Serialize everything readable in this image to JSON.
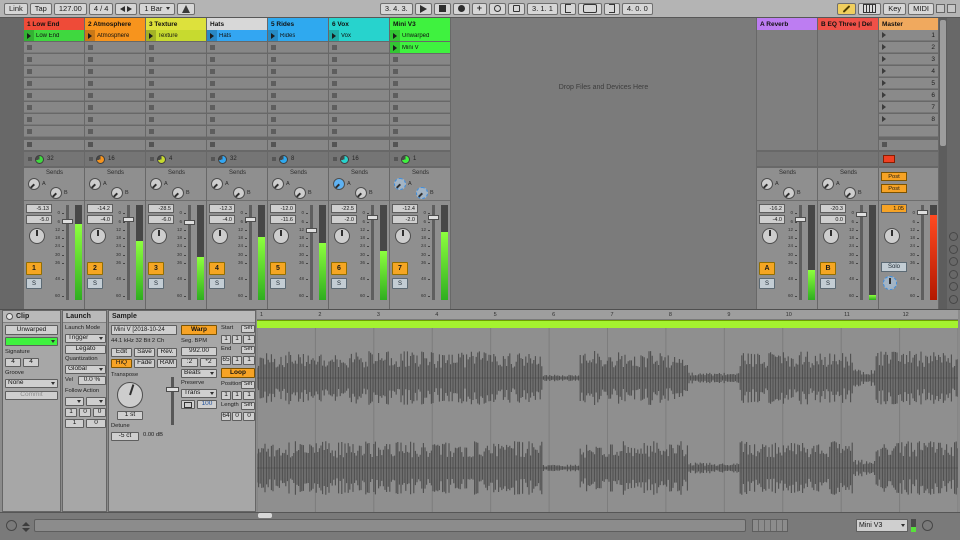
{
  "control_bar": {
    "link": "Link",
    "tap": "Tap",
    "tempo": "127.00",
    "time_sig": "4 / 4",
    "quantize": "1 Bar",
    "arrangement_position": "3. 4. 3.",
    "loop_start": "3. 1. 1",
    "loop_length": "4. 0. 0",
    "key": "Key",
    "midi": "MIDI"
  },
  "session": {
    "drop_text": "Drop Files and Devices Here",
    "sends_label": "Sends",
    "send_letters": [
      "A",
      "B"
    ],
    "solo_label": "S",
    "fader_scale": [
      0,
      6,
      12,
      18,
      24,
      30,
      36,
      48,
      60
    ],
    "scene_numbers": [
      "1",
      "2",
      "3",
      "4",
      "5",
      "6",
      "7",
      "8"
    ],
    "view_toggles": [
      "overview-icon",
      "io-icon",
      "sends-icon",
      "returns-icon",
      "mixer-icon",
      "crossfader-icon"
    ],
    "tracks": [
      {
        "name": "1 Low End",
        "color": "#ee4b38",
        "clips": [
          {
            "row": 0,
            "name": "Low End",
            "color": "#3fd83f"
          }
        ],
        "activator": "1",
        "beats": "32",
        "peak": "-5.13",
        "vol": "-5.0",
        "meter": 0.8,
        "sends": [
          "normal",
          "normal"
        ]
      },
      {
        "name": "2 Atmosphere",
        "color": "#f7941d",
        "clips": [
          {
            "row": 0,
            "name": "Atmosphere",
            "color": "#f7941d"
          }
        ],
        "activator": "2",
        "beats": "16",
        "peak": "-14.2",
        "vol": "-4.0",
        "meter": 0.62,
        "sends": [
          "normal",
          "normal"
        ]
      },
      {
        "name": "3 Texture",
        "color": "#dde13c",
        "clips": [
          {
            "row": 0,
            "name": "Texture",
            "color": "#c7da2f"
          }
        ],
        "activator": "3",
        "beats": "4",
        "peak": "-28.5",
        "vol": "-6.0",
        "meter": 0.45,
        "sends": [
          "normal",
          "normal"
        ]
      },
      {
        "name": "Hats",
        "color": "#d8d8d8",
        "clips": [
          {
            "row": 0,
            "name": "Hats",
            "color": "#33a6f2"
          }
        ],
        "activator": "4",
        "beats": "32",
        "peak": "-12.3",
        "vol": "-4.0",
        "meter": 0.66,
        "sends": [
          "normal",
          "normal"
        ]
      },
      {
        "name": "5 Rides",
        "color": "#2fa9ef",
        "clips": [
          {
            "row": 0,
            "name": "Rides",
            "color": "#2fa9ef"
          }
        ],
        "activator": "5",
        "beats": "8",
        "peak": "-12.0",
        "vol": "-11.6",
        "meter": 0.6,
        "sends": [
          "normal",
          "normal"
        ]
      },
      {
        "name": "6 Vox",
        "color": "#27d3cd",
        "clips": [
          {
            "row": 0,
            "name": "Vox",
            "color": "#27d3cd"
          }
        ],
        "activator": "6",
        "beats": "16",
        "peak": "-22.5",
        "vol": "-2.0",
        "meter": 0.52,
        "sends": [
          "blue",
          "normal"
        ]
      },
      {
        "name": "Mini V3",
        "color": "#3ff23f",
        "clips": [
          {
            "row": 0,
            "name": "Unwarped",
            "color": "#3ff23f"
          },
          {
            "row": 1,
            "name": "Mini V",
            "color": "#3ff23f"
          }
        ],
        "activator": "7",
        "beats": "1",
        "peak": "-12.4",
        "vol": "-2.0",
        "meter": 0.72,
        "sends": [
          "dashed",
          "dashed"
        ]
      }
    ],
    "returns": [
      {
        "name": "A Reverb",
        "color": "#bd7df2",
        "activator": "A",
        "peak": "-16.2",
        "vol": "-4.0",
        "meter": 0.32
      },
      {
        "name": "B EQ Three | Del",
        "color": "#f05148",
        "activator": "B",
        "peak": "-20.3",
        "vol": "0.0",
        "meter": 0.05
      }
    ],
    "master": {
      "name": "Master",
      "color": "#f0a95e",
      "value": "1.05",
      "post_labels": [
        "Post",
        "Post"
      ],
      "solo_label": "Solo",
      "meter": 0.9
    }
  },
  "clip_panel": {
    "title": "Clip",
    "name": "Unwarped",
    "color": "#3ff23f",
    "signature_label": "Signature",
    "signature_num": "4",
    "signature_den": "4",
    "groove_label": "Groove",
    "groove": "None",
    "commit": "Commit"
  },
  "launch_panel": {
    "title": "Launch",
    "launch_mode_label": "Launch Mode",
    "launch_mode": "Trigger",
    "legato": "Legato",
    "quantization_label": "Quantization",
    "quantization": "Global",
    "vel_label": "Vel",
    "vel": "0.0 %",
    "follow_action_label": "Follow Action",
    "follow_time": [
      "1",
      "0",
      "0"
    ],
    "follow_chance": [
      "1",
      "0"
    ]
  },
  "sample_panel": {
    "title": "Sample",
    "file_name": "Mini V [2018-10-24",
    "file_info": "44.1 kHz 32 Bit 2 Ch",
    "edit": "Edit",
    "save": "Save",
    "rev": "Rev.",
    "hiq": "HiQ",
    "fade": "Fade",
    "ram": "RAM",
    "warp": "Warp",
    "seg_bpm_label": "Seg. BPM",
    "seg_bpm": "992.00",
    "half_tempo": ":2",
    "double_tempo": "*2",
    "warp_mode": "Beats",
    "preserve_label": "Preserve",
    "preserve": "Trans",
    "transient_env": "100",
    "transpose_label": "Transpose",
    "transpose_value": "1 st",
    "detune_label": "Detune",
    "detune_value": "-5 ct",
    "gain_value": "0.00 dB",
    "start_label": "Start",
    "end_label": "End",
    "loop_label": "Loop",
    "position_label": "Position",
    "length_label": "Length",
    "set_label": "Set",
    "start": [
      "1",
      "1",
      "1"
    ],
    "end": [
      "65",
      "1",
      "1"
    ],
    "position": [
      "1",
      "1",
      "1"
    ],
    "length": [
      "64",
      "0",
      "0"
    ]
  },
  "waveform": {
    "bars": [
      "1",
      "2",
      "3",
      "4",
      "5",
      "6",
      "7",
      "8",
      "9",
      "10",
      "11",
      "12"
    ],
    "zoom": "1/4"
  },
  "footer": {
    "track": "Mini V3"
  }
}
